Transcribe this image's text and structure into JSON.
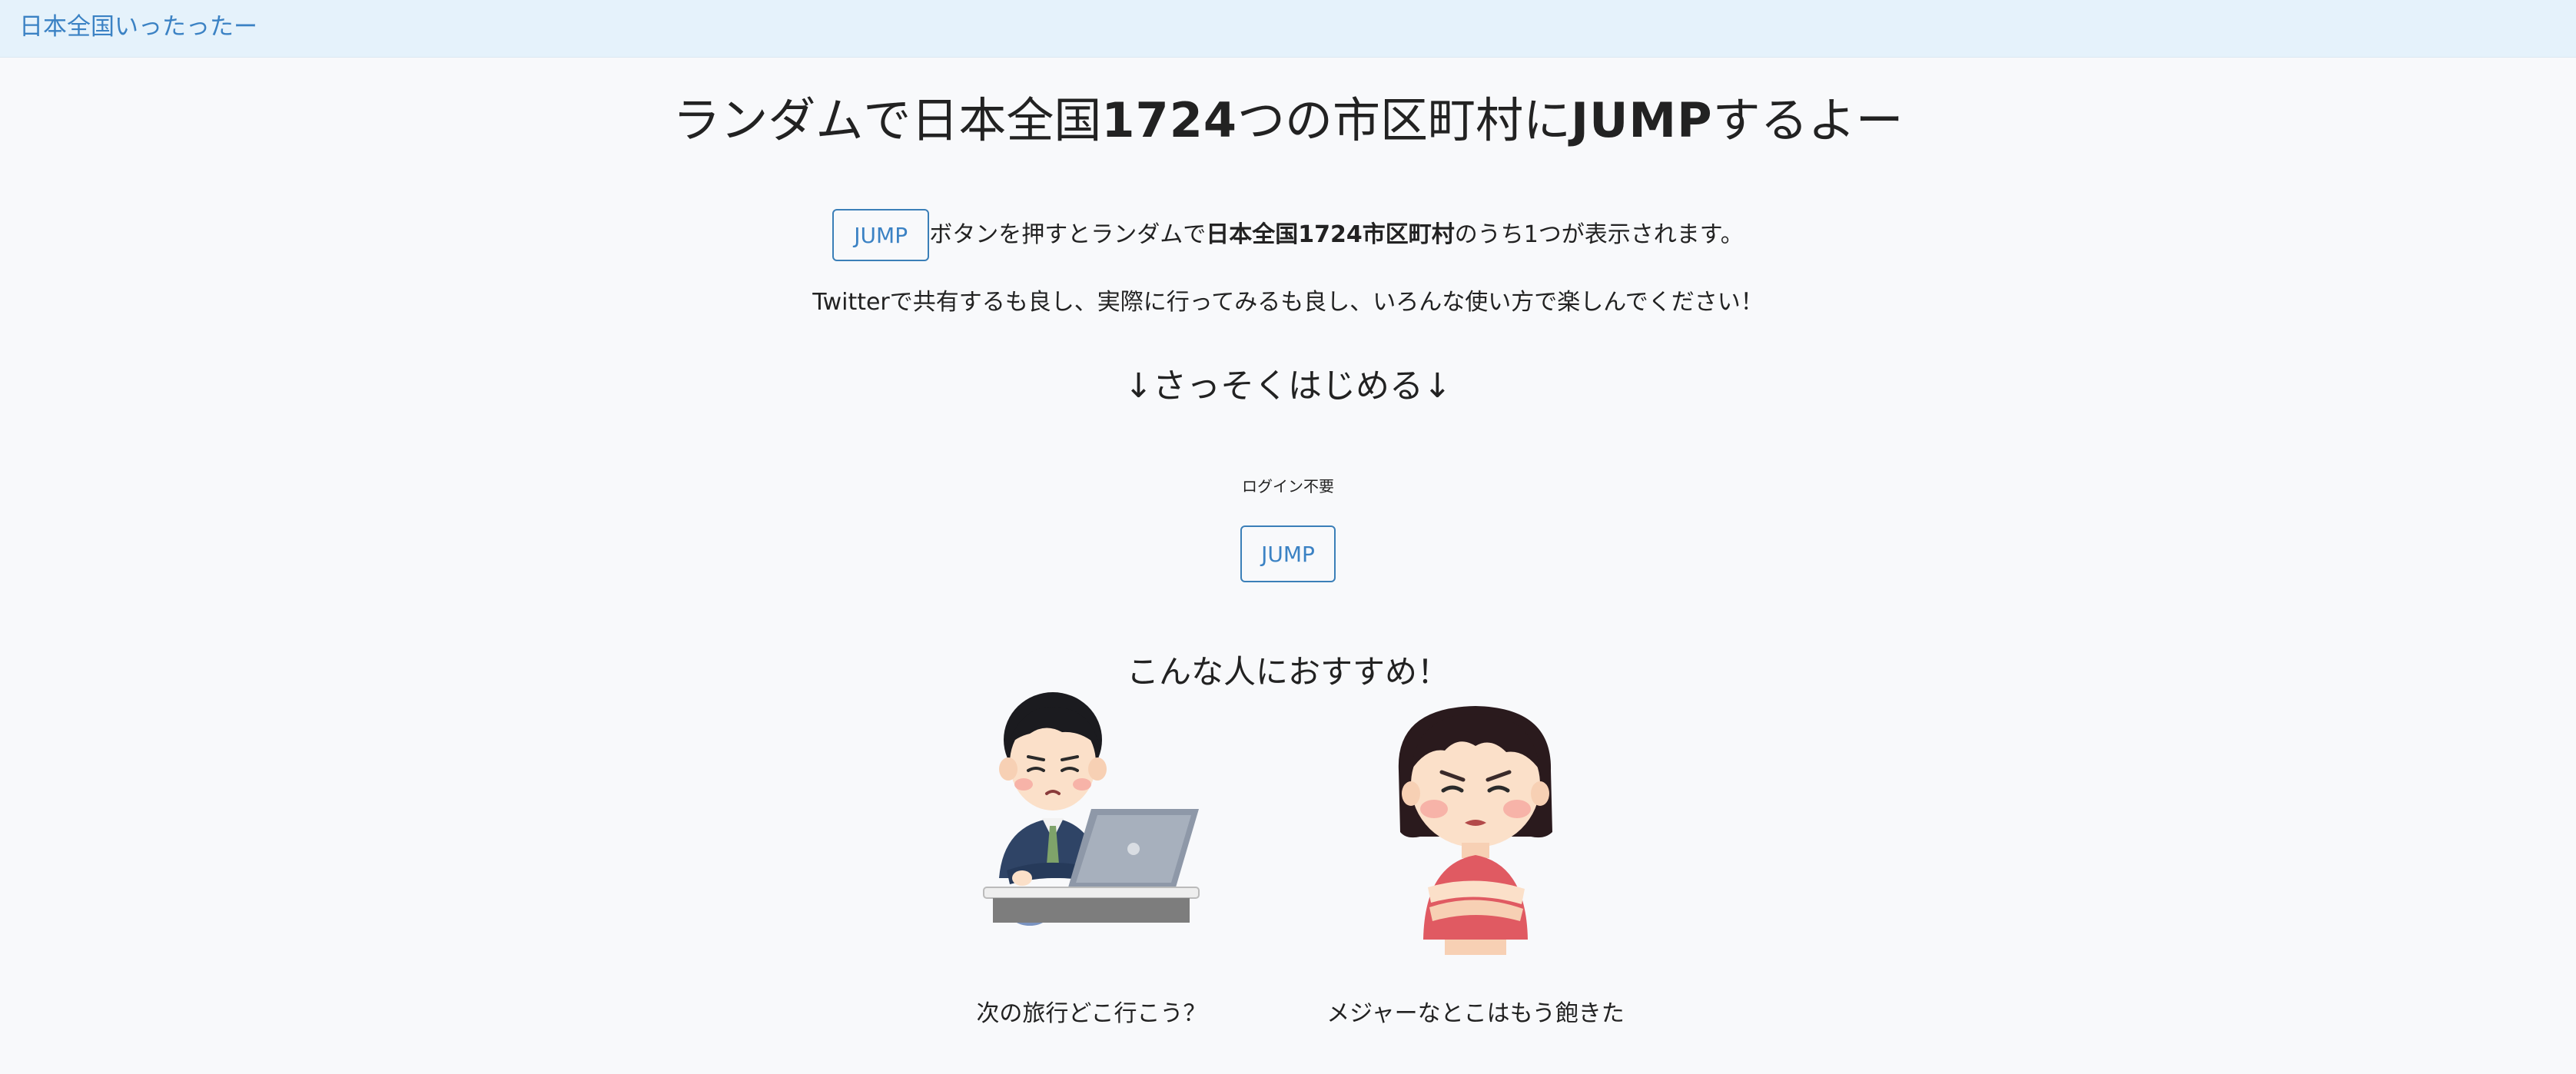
{
  "navbar": {
    "brand": "日本全国いったったー"
  },
  "headline": {
    "part1": "ランダムで日本全国",
    "count": "1724",
    "part2": "つの市区町村に",
    "jump": "JUMP",
    "part3": "するよー"
  },
  "intro": {
    "jump_button": "JUMP",
    "text1": "ボタンを押すとランダムで",
    "bold": "日本全国1724市区町村",
    "text2": "のうち1つが表示されます。"
  },
  "line2": "Twitterで共有するも良し、実際に行ってみるも良し、いろんな使い方で楽しんでください！",
  "start_heading": "↓さっそくはじめる↓",
  "no_login": "ログイン不要",
  "main_jump_button": "JUMP",
  "recommend_heading": "こんな人におすすめ！",
  "personas": [
    {
      "caption": "次の旅行どこ行こう？",
      "icon": "businessman-laptop-illustration"
    },
    {
      "caption": "メジャーなとこはもう飽きた",
      "icon": "girl-arms-crossed-illustration"
    }
  ],
  "colors": {
    "navbar_bg": "#e5f2fb",
    "brand": "#3b82c4",
    "button_border": "#3b7fb8",
    "page_bg": "#f8f9fb"
  }
}
